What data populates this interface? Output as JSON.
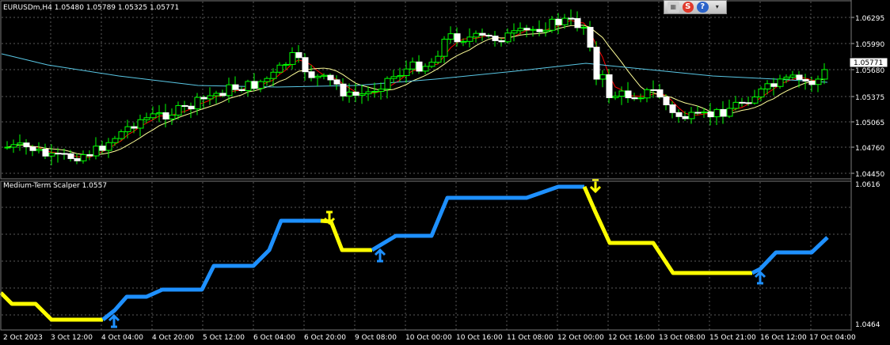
{
  "chart": {
    "title": "EURUSDm,H4  1.05480 1.05789 1.05325 1.05771",
    "price_levels": [
      "1.06295",
      "1.05990",
      "1.05680",
      "1.05375",
      "1.05065",
      "1.04760",
      "1.04450"
    ],
    "current_price": "1.05771",
    "price_min": 1.0445,
    "price_max": 1.063
  },
  "indicator": {
    "title": "Medium-Term Scalper 1.0557",
    "levels": [
      "1.0616",
      "1.0464"
    ]
  },
  "time_labels": [
    "2 Oct 2023",
    "3 Oct 12:00",
    "4 Oct 04:00",
    "4 Oct 20:00",
    "5 Oct 12:00",
    "6 Oct 04:00",
    "6 Oct 20:00",
    "9 Oct 08:00",
    "10 Oct 00:00",
    "10 Oct 16:00",
    "11 Oct 08:00",
    "12 Oct 00:00",
    "12 Oct 16:00",
    "13 Oct 08:00",
    "15 Oct 21:00",
    "16 Oct 12:00",
    "17 Oct 04:00"
  ],
  "toolbar": {
    "grid_icon": "grid-icon",
    "s_label": "S",
    "help_label": "?",
    "menu_label": "▾"
  },
  "colors": {
    "bull_body": "#000000",
    "bull_border": "#00ff00",
    "bear_body": "#ffffff",
    "ma_fast": "#ff0000",
    "ma_mid": "#ffff99",
    "ma_slow": "#5ac8e6",
    "trend_up": "#1e90ff",
    "trend_down": "#ffff00",
    "grid": "#5a5a5a"
  }
}
